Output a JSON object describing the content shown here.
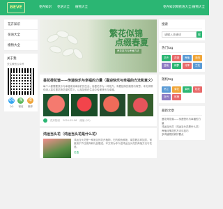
{
  "header": {
    "logo": "BEVE",
    "nav": [
      "花卉知识",
      "花语大全",
      "植物大全"
    ],
    "site_tag": "花卉知识网花语大全|植物大全"
  },
  "leftnav": {
    "items": [
      "花卉知识",
      "花语大全",
      "植物大全"
    ],
    "about_title": "关于我",
    "about_text": "关注微信公众号",
    "social": [
      {
        "icon": "QQ",
        "label": "QQ",
        "color": "#3aa7f0"
      },
      {
        "icon": "微",
        "label": "微信",
        "color": "#5cb85c"
      },
      {
        "icon": "博",
        "label": "微博",
        "color": "#f0a63a"
      }
    ]
  },
  "banner": {
    "title_line1": "繁花似锦",
    "title_line2": "点缀春夏",
    "sub": "养花技巧与养殖方法"
  },
  "post1": {
    "title": "昙花荷花谱——传递快乐与幸福的力量（喜迎快乐与幸福的方法和意义）",
    "text": "每个人都需要快乐与幸福来润泽我们的生活，而昙花作为一种花卉，有着独特的美丽与寓意。本文将带你深入探讨昙花荷花谱的意义，以及如何在生活中传递快乐与幸福。",
    "author": "花卉知识",
    "date": "2024-05-06",
    "views": "阅读 (12)"
  },
  "post2": {
    "title": "鸿运当头花（鸿运当头花是什么花）",
    "text": "鸿运当头花是一种常见的花卉植物，它的颜色鲜艳，寓意着吉祥如意，常被用于节日装饰和礼品赠送。本文将为你介绍鸿运当头花的养殖方法与花语。",
    "tag": "花语"
  },
  "right": {
    "search_title": "搜索",
    "search_placeholder": "请输入关键词",
    "search_button": "搜",
    "hot_title": "热门tag",
    "tags": [
      {
        "text": "花卉",
        "color": "#2bb673"
      },
      {
        "text": "花语",
        "color": "#e86a6a"
      },
      {
        "text": "养殖",
        "color": "#5b9bd5"
      },
      {
        "text": "多肉",
        "color": "#f0a63a"
      },
      {
        "text": "盆栽",
        "color": "#8e7cc3"
      },
      {
        "text": "绿萝",
        "color": "#2bb673"
      },
      {
        "text": "月季",
        "color": "#e86a6a"
      },
      {
        "text": "兰花",
        "color": "#5b9bd5"
      }
    ],
    "random_title": "随机tag",
    "random_tags": [
      {
        "text": "吊兰",
        "color": "#5b9bd5"
      },
      {
        "text": "菊花",
        "color": "#f0a63a"
      },
      {
        "text": "茉莉",
        "color": "#2bb673"
      },
      {
        "text": "桂花",
        "color": "#e86a6a"
      },
      {
        "text": "牡丹",
        "color": "#8e7cc3"
      },
      {
        "text": "玫瑰",
        "color": "#e86a6a"
      }
    ],
    "latest_title": "最新文章",
    "latest": [
      "昙花荷花谱——传递快乐与幸福的力量",
      "鸿运当头花（鸿运当头花是什么花）",
      "养殖月季花的方法与技巧",
      "多肉植物的养护要点"
    ]
  }
}
